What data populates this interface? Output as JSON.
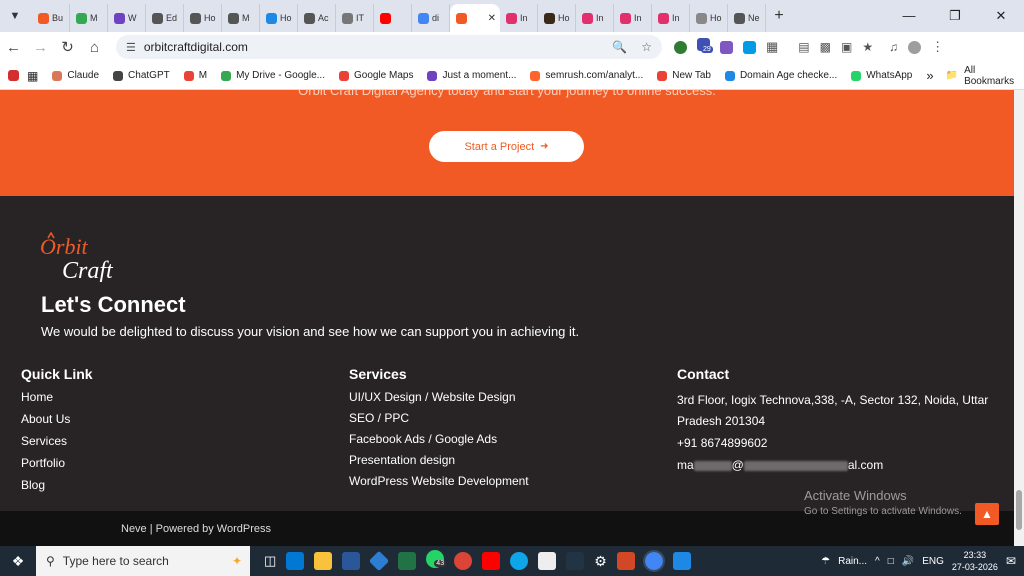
{
  "tabs": [
    {
      "label": "Bu",
      "color": "#f15a24"
    },
    {
      "label": "M",
      "color": "#34a853"
    },
    {
      "label": "W",
      "color": "#6f42c1"
    },
    {
      "label": "Ed",
      "color": "#555555"
    },
    {
      "label": "Ho",
      "color": "#555555"
    },
    {
      "label": "M",
      "color": "#555555"
    },
    {
      "label": "Ho",
      "color": "#1e88e5"
    },
    {
      "label": "Ac",
      "color": "#555555"
    },
    {
      "label": "IT",
      "color": "#777777"
    },
    {
      "label": "",
      "color": "#ff0000"
    },
    {
      "label": "di",
      "color": "#4285f4"
    },
    {
      "label": "",
      "color": "#f15a24",
      "active": true
    },
    {
      "label": "In",
      "color": "#e1306c"
    },
    {
      "label": "Ho",
      "color": "#3a2a1a"
    },
    {
      "label": "In",
      "color": "#e1306c"
    },
    {
      "label": "In",
      "color": "#e1306c"
    },
    {
      "label": "In",
      "color": "#e1306c"
    },
    {
      "label": "Ho",
      "color": "#888888"
    },
    {
      "label": "Ne",
      "color": "#555555"
    }
  ],
  "address": {
    "url": "orbitcraftdigital.com"
  },
  "bookmarks": [
    {
      "label": "Claude",
      "color": "#d97757"
    },
    {
      "label": "ChatGPT",
      "color": "#444444"
    },
    {
      "label": "M",
      "color": "#ea4335"
    },
    {
      "label": "My Drive - Google...",
      "color": "#34a853"
    },
    {
      "label": "Google Maps",
      "color": "#ea4335"
    },
    {
      "label": "Just a moment...",
      "color": "#6f42c1"
    },
    {
      "label": "semrush.com/analyt...",
      "color": "#ff642d"
    },
    {
      "label": "New Tab",
      "color": "#ea4335"
    },
    {
      "label": "Domain Age checke...",
      "color": "#1e88e5"
    },
    {
      "label": "WhatsApp",
      "color": "#25d366"
    }
  ],
  "all_bookmarks": "All Bookmarks",
  "hero": {
    "partial_text": "Orbit Craft Digital Agency today and start your journey to online success.",
    "cta": "Start a Project"
  },
  "footer": {
    "logo_top": "Orbit",
    "logo_bottom": "Craft",
    "heading": "Let's Connect",
    "tagline": "We would be delighted to discuss your vision and see how we can support you in achieving it.",
    "quick_links": {
      "title": "Quick Link",
      "items": [
        "Home",
        "About Us",
        "Services",
        "Portfolio",
        "Blog"
      ]
    },
    "services": {
      "title": "Services",
      "items": [
        "UI/UX Design / Website Design",
        "SEO / PPC",
        "Facebook Ads / Google Ads",
        "Presentation design",
        "WordPress Website Development"
      ]
    },
    "contact": {
      "title": "Contact",
      "address": "3rd Floor, Iogix Technova,338, -A, Sector 132, Noida, Uttar Pradesh 201304",
      "phone": "+91 8674899602",
      "email_prefix": "ma",
      "email_at": "@",
      "email_suffix": "al.com"
    },
    "credit": "Neve | Powered by WordPress"
  },
  "activate": {
    "line1": "Activate Windows",
    "line2": "Go to Settings to activate Windows."
  },
  "taskbar": {
    "search_placeholder": "Type here to search",
    "whatsapp_badge": "43",
    "weather": "Rain...",
    "lang": "ENG",
    "time": "23:33",
    "date": "27-03-2026"
  },
  "ext_badge": "29",
  "colors": {
    "accent": "#f15a24",
    "footer_bg": "#282425"
  }
}
